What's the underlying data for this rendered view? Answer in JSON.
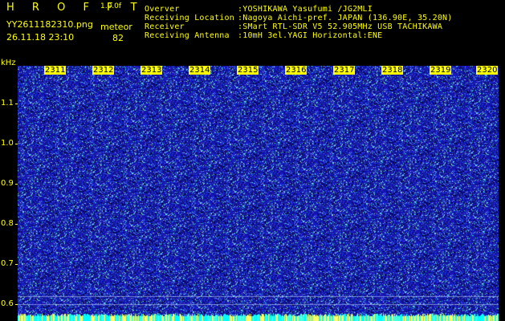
{
  "header": {
    "logo": "H R O F F T",
    "version": "1.0.0f",
    "filename": "YY2611182310.png",
    "meteor_label": "meteor",
    "datetime": "26.11.18 23:10",
    "meteor_count": "82"
  },
  "station": {
    "labels": [
      "Overver",
      "Receiving Location",
      "Receiver",
      "Receiving Antenna"
    ],
    "values": [
      ":YOSHIKAWA Yasufumi /JG2MLI",
      ":Nagoya Aichi-pref. JAPAN (136.90E, 35.20N)",
      ":SMart RTL-SDR V5 52.905MHz USB TACHIKAWA",
      ":10mH 3el.YAGI Horizontal:ENE"
    ]
  },
  "axis": {
    "y_unit": "kHz",
    "y_ticks": [
      "1.1",
      "1.0",
      "0.9",
      "0.8",
      "0.7",
      "0.6"
    ],
    "x_ticks": [
      "2311",
      "2312",
      "2313",
      "2314",
      "2315",
      "2316",
      "2317",
      "2318",
      "2319",
      "2320"
    ]
  },
  "colors": {
    "text": "#ffff00",
    "background": "#000000",
    "noise_base": "#1515a8",
    "noise_bright": "#00ffff",
    "bottom_band": "#00ffff"
  }
}
